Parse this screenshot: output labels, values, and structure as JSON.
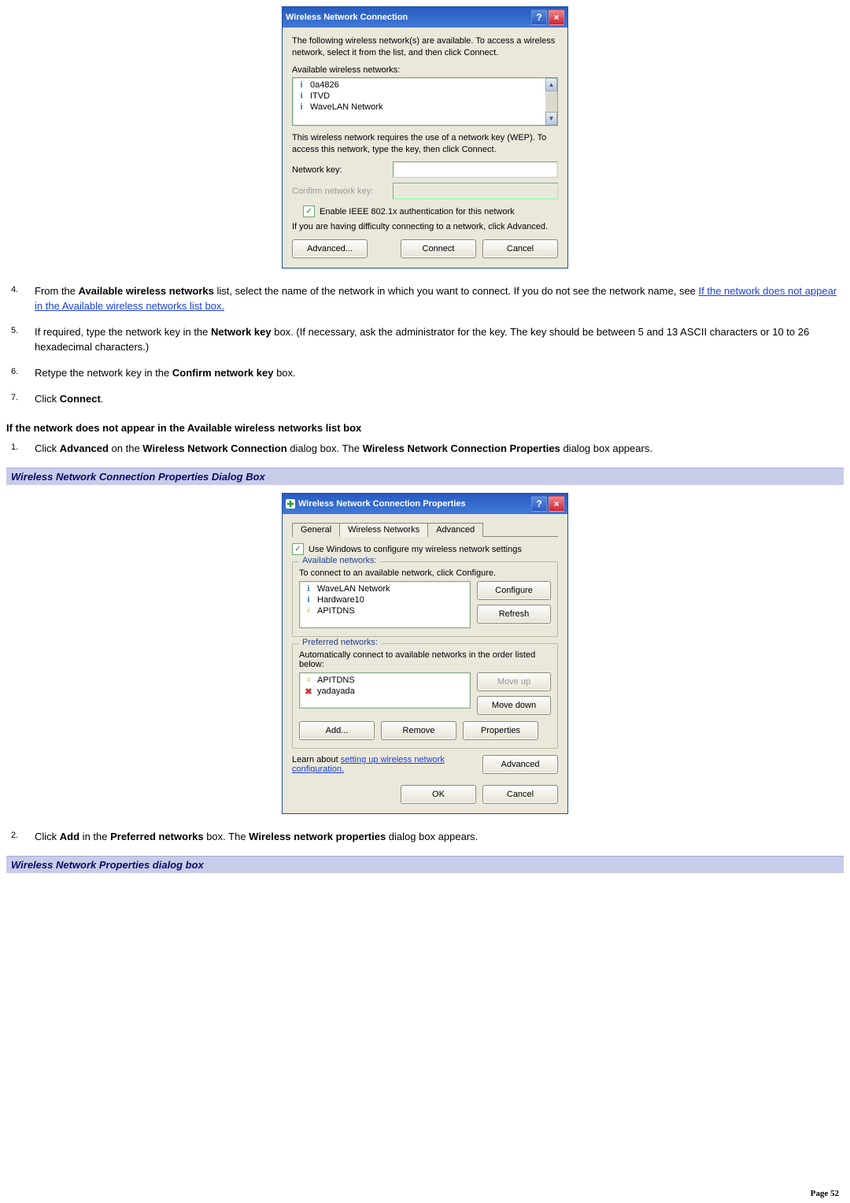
{
  "dialog1": {
    "title": "Wireless Network Connection",
    "intro": "The following wireless network(s) are available. To access a wireless network, select it from the list, and then click Connect.",
    "available_label": "Available wireless networks:",
    "networks": [
      "0a4826",
      "ITVD",
      "WaveLAN Network"
    ],
    "wep_note": "This wireless network requires the use of a network key (WEP). To access this network, type the key, then click Connect.",
    "network_key_label": "Network key:",
    "confirm_key_label": "Confirm network key:",
    "enable_8021x_label": "Enable IEEE 802.1x authentication for this network",
    "difficulty_note": "If you are having difficulty connecting to a network, click Advanced.",
    "advanced_btn": "Advanced...",
    "connect_btn": "Connect",
    "cancel_btn": "Cancel"
  },
  "steps_a": {
    "s4_pre": "From the ",
    "s4_b1": "Available wireless networks",
    "s4_mid": " list, select the name of the network in which you want to connect. If you do not see the network name, see ",
    "s4_link": "If the network does not appear in the Available wireless networks list box.",
    "s5_pre": "If required, type the network key in the ",
    "s5_b1": "Network key",
    "s5_post": " box. (If necessary, ask the administrator for the key. The key should be between 5 and 13 ASCII characters or 10 to 26 hexadecimal characters.)",
    "s6_pre": "Retype the network key in the ",
    "s6_b1": "Confirm network key",
    "s6_post": " box.",
    "s7_pre": "Click ",
    "s7_b1": "Connect",
    "s7_post": "."
  },
  "heading_b": "If the network does not appear in the Available wireless networks list box",
  "steps_b": {
    "s1_pre": "Click ",
    "s1_b1": "Advanced",
    "s1_mid": " on the ",
    "s1_b2": "Wireless Network Connection",
    "s1_mid2": " dialog box. The ",
    "s1_b3": "Wireless Network Connection Properties",
    "s1_post": " dialog box appears."
  },
  "figure1_title": "Wireless Network Connection Properties Dialog Box",
  "dialog2": {
    "title": "Wireless Network Connection Properties",
    "tabs": [
      "General",
      "Wireless Networks",
      "Advanced"
    ],
    "use_windows_label": "Use Windows to configure my wireless network settings",
    "available_legend": "Available networks:",
    "available_hint": "To connect to an available network, click Configure.",
    "available_items": [
      "WaveLAN Network",
      "Hardware10",
      "APITDNS"
    ],
    "configure_btn": "Configure",
    "refresh_btn": "Refresh",
    "preferred_legend": "Preferred networks:",
    "preferred_hint": "Automatically connect to available networks in the order listed below:",
    "preferred_items": [
      "APITDNS",
      "yadayada"
    ],
    "moveup_btn": "Move up",
    "movedown_btn": "Move down",
    "add_btn": "Add...",
    "remove_btn": "Remove",
    "properties_btn": "Properties",
    "learn_pre": "Learn about ",
    "learn_link": "setting up wireless network configuration.",
    "advanced_btn": "Advanced",
    "ok_btn": "OK",
    "cancel_btn": "Cancel"
  },
  "steps_c": {
    "s2_pre": "Click ",
    "s2_b1": "Add",
    "s2_mid": " in the ",
    "s2_b2": "Preferred networks",
    "s2_mid2": " box. The ",
    "s2_b3": "Wireless network properties",
    "s2_post": " dialog box appears."
  },
  "figure2_title": "Wireless Network Properties dialog box",
  "footer": {
    "label": "Page ",
    "num": "52"
  }
}
